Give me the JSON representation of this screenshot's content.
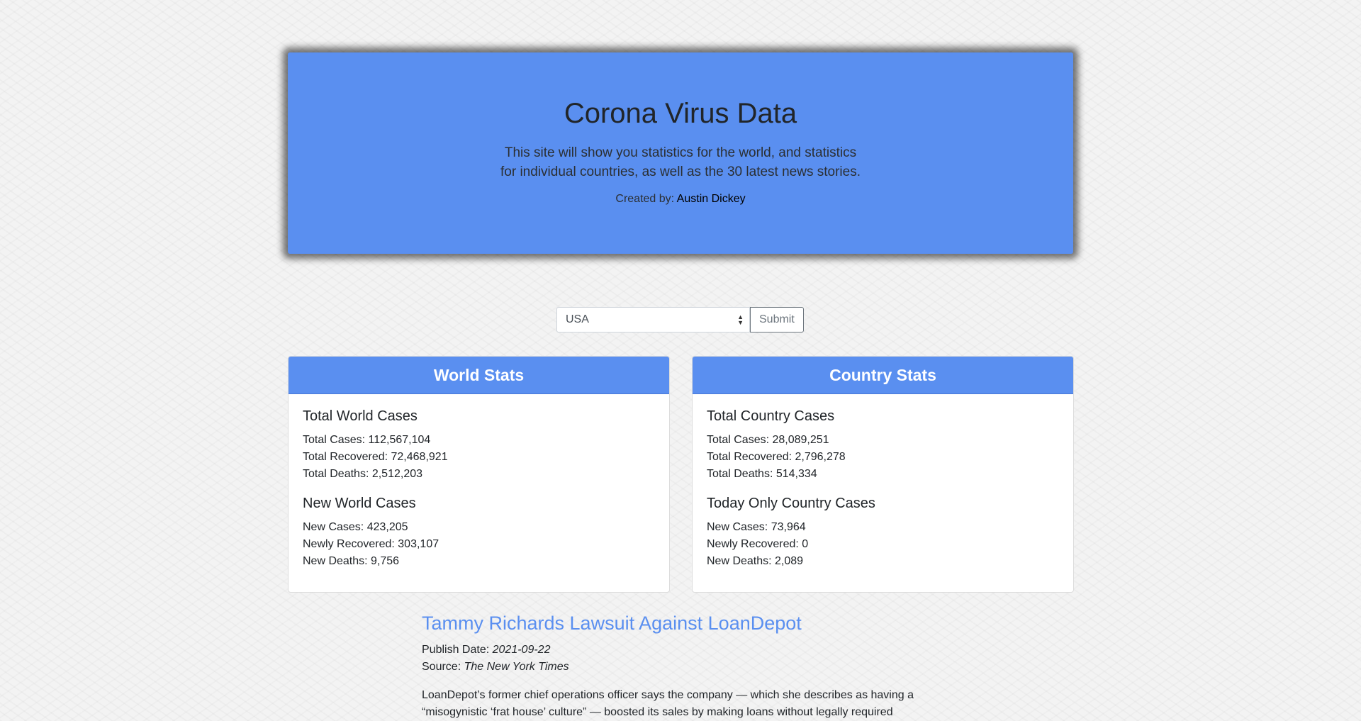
{
  "hero": {
    "title": "Corona Virus Data",
    "lead": "This site will show you statistics for the world, and statistics for individual countries, as well as the 30 latest news stories.",
    "credit_label": "Created by:",
    "credit_name": "Austin Dickey"
  },
  "form": {
    "selected_country": "USA",
    "submit_label": "Submit"
  },
  "world": {
    "header": "World Stats",
    "total_title": "Total World Cases",
    "total_cases": "Total Cases: 112,567,104",
    "total_recovered": "Total Recovered: 72,468,921",
    "total_deaths": "Total Deaths: 2,512,203",
    "new_title": "New World Cases",
    "new_cases": "New Cases: 423,205",
    "new_recovered": "Newly Recovered: 303,107",
    "new_deaths": "New Deaths: 9,756"
  },
  "country": {
    "header": "Country Stats",
    "total_title": "Total Country Cases",
    "total_cases": "Total Cases: 28,089,251",
    "total_recovered": "Total Recovered: 2,796,278",
    "total_deaths": "Total Deaths: 514,334",
    "new_title": "Today Only Country Cases",
    "new_cases": "New Cases: 73,964",
    "new_recovered": "Newly Recovered: 0",
    "new_deaths": "New Deaths: 2,089"
  },
  "news": {
    "title": "Tammy Richards Lawsuit Against LoanDepot",
    "publish_label": "Publish Date:",
    "publish_date": "2021-09-22",
    "source_label": "Source:",
    "source": "The New York Times",
    "description": "LoanDepot’s former chief operations officer says the company — which she describes as having a “misogynistic ‘frat house’ culture” — boosted its sales by making loans without legally required"
  },
  "colors": {
    "accent": "#5a8ff0"
  }
}
